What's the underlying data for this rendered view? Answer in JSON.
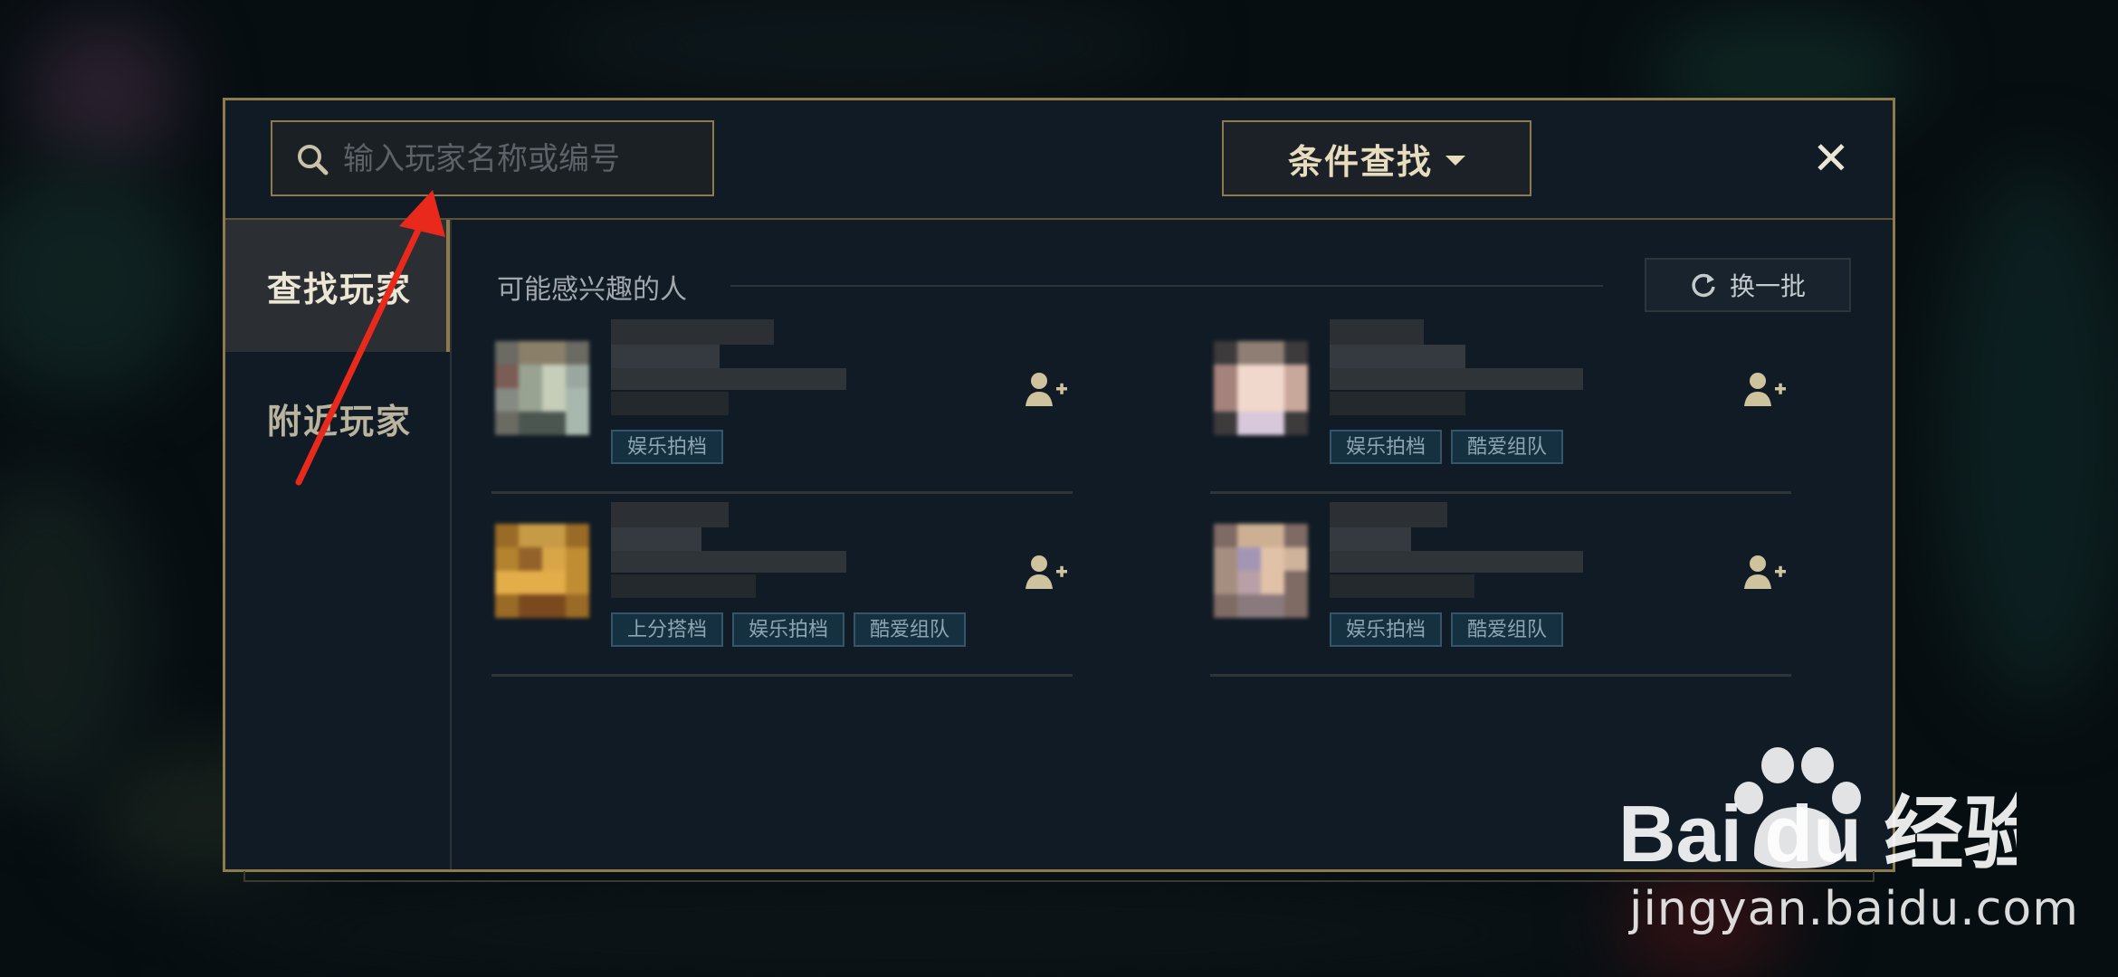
{
  "search": {
    "placeholder": "输入玩家名称或编号"
  },
  "header": {
    "filter_label": "条件查找",
    "close_label": "✕"
  },
  "sidebar": {
    "items": [
      {
        "label": "查找玩家"
      },
      {
        "label": "附近玩家"
      }
    ]
  },
  "section": {
    "title": "可能感兴趣的人",
    "refresh_label": "换一批"
  },
  "players": [
    {
      "tags": [
        "娱乐拍档"
      ]
    },
    {
      "tags": [
        "娱乐拍档",
        "酷爱组队"
      ]
    },
    {
      "tags": [
        "上分搭档",
        "娱乐拍档",
        "酷爱组队"
      ]
    },
    {
      "tags": [
        "娱乐拍档",
        "酷爱组队"
      ]
    }
  ],
  "watermark": {
    "brand": "Bai du 经验",
    "url": "jingyan.baidu.com"
  },
  "colors": {
    "gold": "#8f7a4b",
    "panel": "#111b25",
    "tag_bg": "#15303f",
    "arrow": "#e8291c"
  },
  "icons": [
    "search-icon",
    "caret-down-icon",
    "close-icon",
    "refresh-icon",
    "add-friend-icon",
    "paw-icon"
  ]
}
